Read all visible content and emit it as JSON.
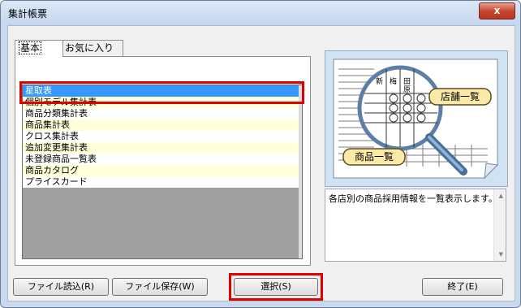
{
  "window": {
    "title": "集計帳票",
    "close_label": "x"
  },
  "tabs": [
    {
      "label": "基本"
    },
    {
      "label": "お気に入り"
    }
  ],
  "list": {
    "items": [
      {
        "label": "星取表"
      },
      {
        "label": "個別モデル集計表"
      },
      {
        "label": "商品分類集計表"
      },
      {
        "label": "商品集計表"
      },
      {
        "label": "クロス集計表"
      },
      {
        "label": "追加変更集計表"
      },
      {
        "label": "未登録商品一覧表"
      },
      {
        "label": "商品カタログ"
      },
      {
        "label": "プライスカード"
      }
    ],
    "selected_index": 0
  },
  "preview": {
    "callout_store": "店舗一覧",
    "callout_product": "商品一覧",
    "header_chars": [
      "新",
      "梅",
      "田",
      "原"
    ]
  },
  "description": "各店別の商品採用情報を一覧表示します。",
  "buttons": {
    "file_load": "ファイル読込(R)",
    "file_save": "ファイル保存(W)",
    "select": "選択(S)",
    "exit": "終了(E)"
  },
  "colors": {
    "selection": "#3399ff",
    "highlight_frame": "#e00000",
    "alt_row": "#ffffd8",
    "title_bar": "#c5d7ef"
  }
}
